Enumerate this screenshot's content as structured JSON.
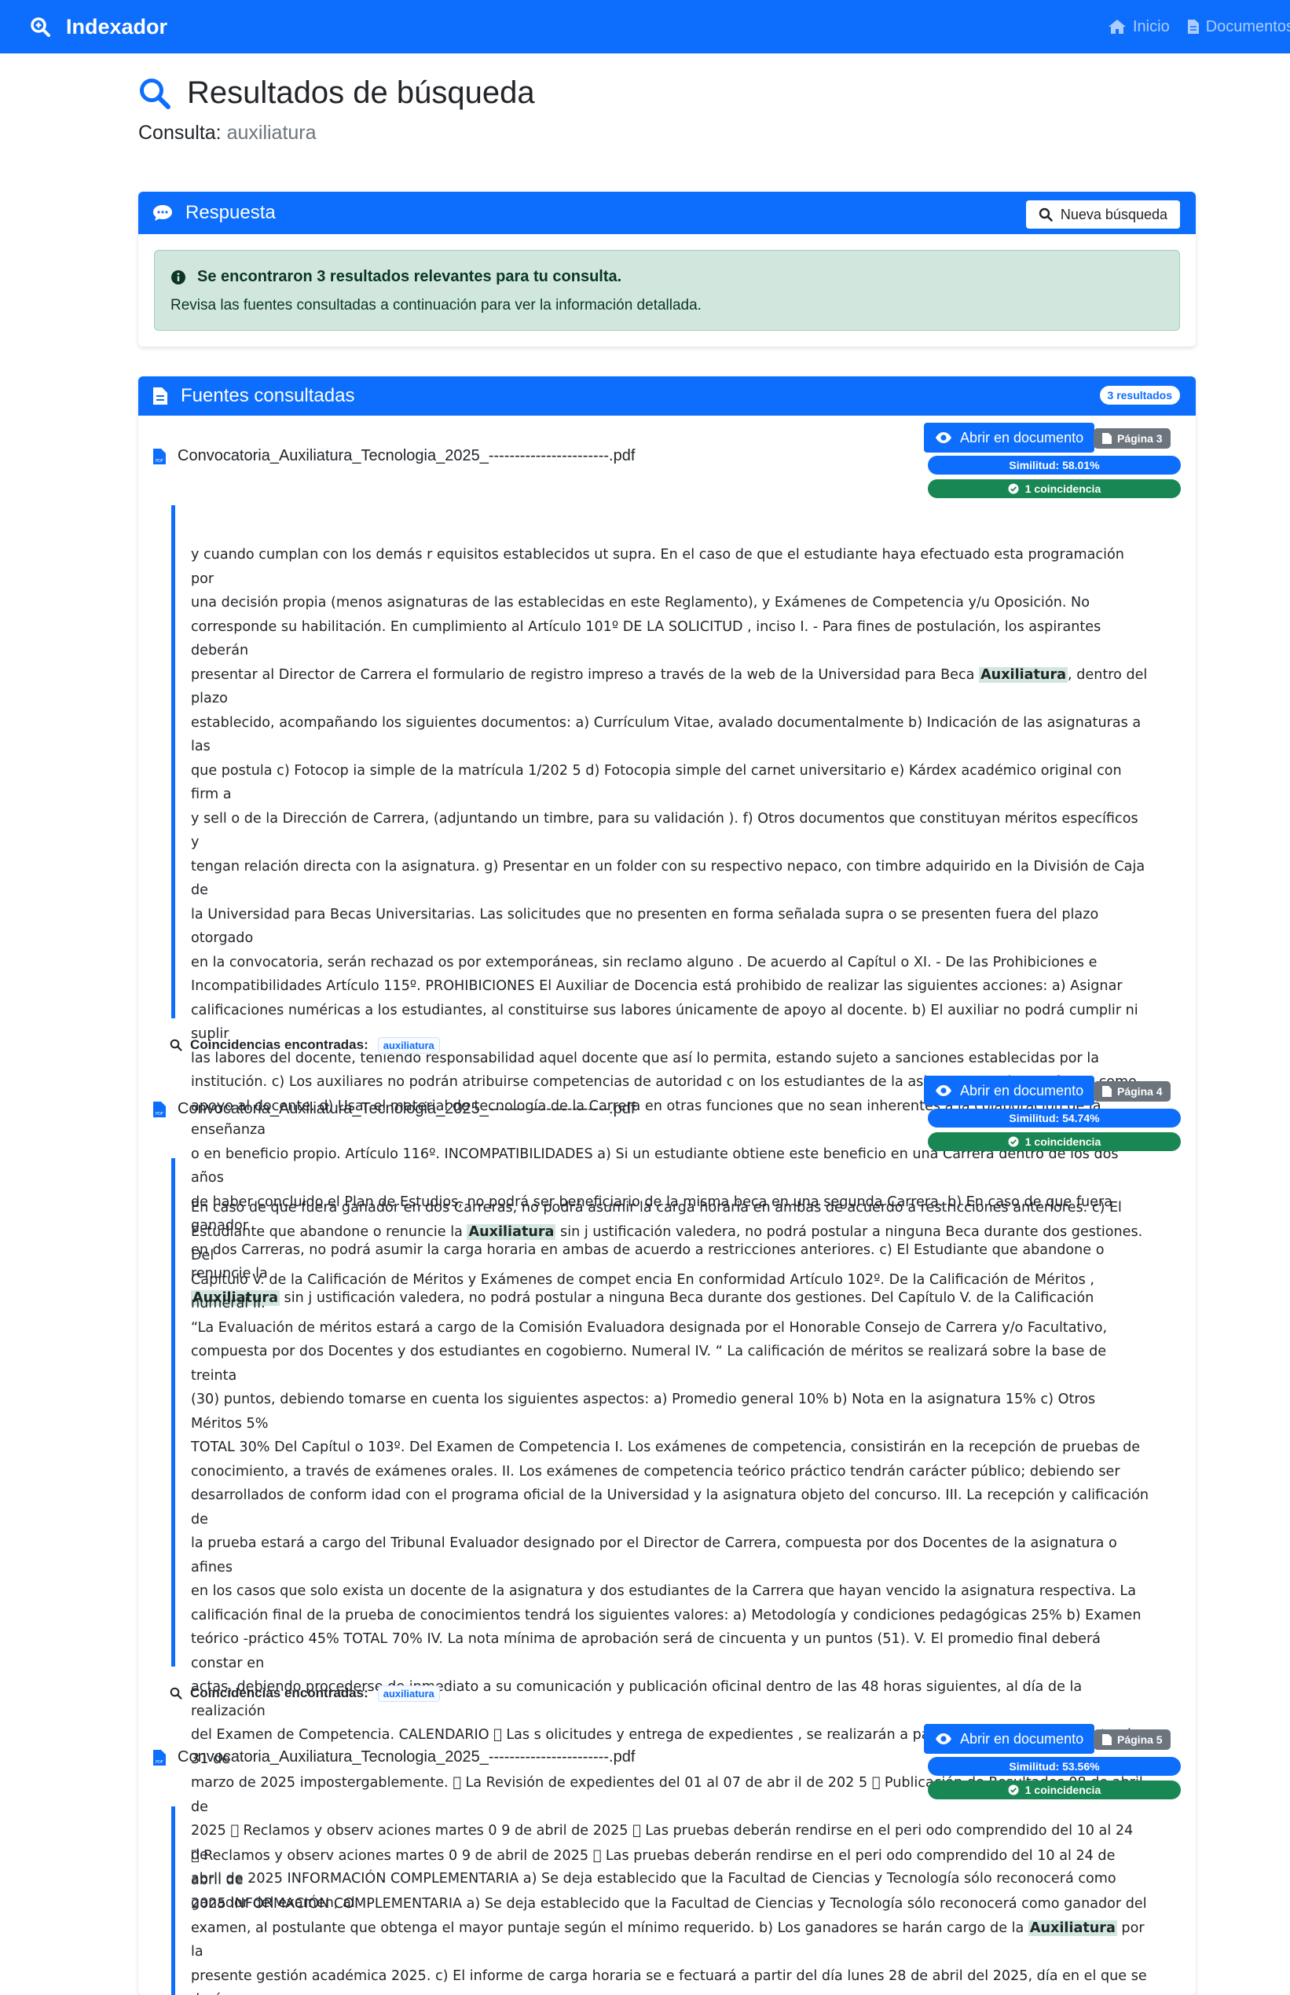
{
  "app": {
    "brand": "Indexador"
  },
  "nav": {
    "home": "Inicio",
    "documents": "Documentos"
  },
  "header": {
    "title": "Resultados de búsqueda",
    "query_label": "Consulta:",
    "query_value": "auxiliatura"
  },
  "response_card": {
    "title": "Respuesta",
    "new_search_label": "Nueva búsqueda",
    "alert_title": "Se encontraron 3 resultados relevantes para tu consulta.",
    "alert_body": "Revisa las fuentes consultadas a continuación para ver la información detallada."
  },
  "sources_card": {
    "title": "Fuentes consultadas",
    "count_badge": "3 resultados"
  },
  "results": [
    {
      "filename": "Convocatoria_Auxiliatura_Tecnologia_2025_-----------------------.pdf",
      "open_label": "Abrir en documento",
      "page_label": "Página 3",
      "similarity_label": "Similitud: 58.01%",
      "matches_label": "1 coincidencia",
      "excerpt_a": "y cuando cumplan con los demás r equisitos establecidos ut supra. En el caso de que el estudiante haya efectuado esta programación por\nuna decisión propia (menos asignaturas de las establecidas en este Reglamento), y Exámenes de Competencia y/u Oposición. No\ncorresponde su habilitación. En cumplimiento al Artículo 101º DE LA SOLICITUD , inciso I. - Para fines de postulación, los aspirantes deberán\npresentar al Director de Carrera el formulario de registro impreso a través de la web de la Universidad para Beca ",
      "excerpt_hl1": "Auxiliatura",
      "excerpt_b": ", dentro del plazo\nestablecido, acompañando los siguientes documentos: a) Currículum Vitae, avalado documentalmente b) Indicación de las asignaturas a las\nque postula c) Fotocop ia simple de la matrícula 1/202 5 d) Fotocopia simple del carnet universitario e) Kárdex académico original con firm a\ny sell o de la Dirección de Carrera, (adjuntando un timbre, para su validación ). f) Otros documentos que constituyan méritos específicos y\ntengan relación directa con la asignatura. g) Presentar en un folder con su respectivo nepaco, con timbre adquirido en la División de Caja de\nla Universidad para Becas Universitarias. Las solicitudes que no presenten en forma señalada supra o se presenten fuera del plazo otorgado\nen la convocatoria, serán rechazad os por extemporáneas, sin reclamo alguno . De acuerdo al Capítul o XI. - De las Prohibiciones e\nIncompatibilidades Artículo 115º. PROHIBICIONES El Auxiliar de Docencia está prohibido de realizar las siguientes acciones: a) Asignar\ncalificaciones numéricas a los estudiantes, al constituirse sus labores únicamente de apoyo al docente. b) El auxiliar no podrá cumplir ni suplir\nlas labores del docente, teniendo responsabilidad aquel docente que así lo permita, estando sujeto a sanciones establecidas por la\ninstitución. c) Los auxiliares no podrán atribuirse competencias de autoridad c on los estudiantes de la asignatura en la que funge como\napoyo al docente. d) Usar el material de tecnología de la Carrera en otras funciones que no sean inherentes a la colaboración de la enseñanza\no en beneficio propio. Artículo 116º. INCOMPATIBILIDADES a) Si un estudiante obtiene este beneficio en una Carrera dentro de los dos años\nde haber concluido el Plan de Estudios, no podrá ser beneficiario de la misma beca en una segunda Carrera. b) En caso de que fuera ganador\nen dos Carreras, no podrá asumir la carga horaria en ambas de acuerdo a restricciones anteriores. c) El Estudiante que abandone o renuncie la\n",
      "excerpt_hl2": "Auxiliatura",
      "excerpt_c": " sin j ustificación valedera, no podrá postular a ninguna Beca durante dos gestiones. Del Capítulo V. de la Calificación",
      "coinc_label": "Coincidencias encontradas:",
      "tag": "auxiliatura"
    },
    {
      "filename": "Convocatoria_Auxiliatura_Tecnologia_2025_-----------------------.pdf",
      "open_label": "Abrir en documento",
      "page_label": "Página 4",
      "similarity_label": "Similitud: 54.74%",
      "matches_label": "1 coincidencia",
      "excerpt_a": "En caso de que fuera ganador en dos Carreras, no podrá asumir la carga horaria en ambas de acuerdo a restricciones anteriores. c) El\nEstudiante que abandone o renuncie la ",
      "excerpt_hl1": "Auxiliatura",
      "excerpt_b": " sin j ustificación valedera, no podrá postular a ninguna Beca durante dos gestiones. Del\nCapítulo V. de la Calificación de Méritos y Exámenes de compet encia En conformidad Artículo 102º. De la Calificación de Méritos , numeral II.\n“La Evaluación de méritos estará a cargo de la Comisión Evaluadora designada por el Honorable Consejo de Carrera y/o Facultativo,\ncompuesta por dos Docentes y dos estudiantes en cogobierno. Numeral IV. “ La calificación de méritos se realizará sobre la base de treinta\n(30) puntos, debiendo tomarse en cuenta los siguientes aspectos: a) Promedio general 10% b) Nota en la asignatura 15% c) Otros Méritos 5%\nTOTAL 30% Del Capítul o 103º. Del Examen de Competencia I. Los exámenes de competencia, consistirán en la recepción de pruebas de\nconocimiento, a través de exámenes orales. II. Los exámenes de competencia teórico práctico tendrán carácter público; debiendo ser\ndesarrollados de conform idad con el programa oficial de la Universidad y la asignatura objeto del concurso. III. La recepción y calificación de\nla prueba estará a cargo del Tribunal Evaluador designado por el Director de Carrera, compuesta por dos Docentes de la asignatura o afines\nen los casos que solo exista un docente de la asignatura y dos estudiantes de la Carrera que hayan vencido la asignatura respectiva. La\ncalificación final de la prueba de conocimientos tendrá los siguientes valores: a) Metodología y condiciones pedagógicas 25% b) Examen\nteórico -práctico 45% TOTAL 70% IV. La nota mínima de aprobación será de cincuenta y un puntos (51). V. El promedio final deberá constar en\nactas, debiendo procederse de inmediato a su comunicación y publicación oficinal dentro de las 48 horas siguientes, al día de la realización\ndel Examen de Competencia. CALENDARIO  Las s olicitudes y entrega de expedientes , se realizarán a pa rtir del 20 de marzo hasta el 31 de\nmarzo de 2025 impostergablemente.  La Revisión de expedientes del 01 al 07 de abr il de 202 5  Publicación de Resultados 08 de abril de\n2025  Reclamos y observ aciones martes 0 9 de abril de 2025  Las pruebas deberán rendirse en el peri odo comprendido del 10 al 24 de\nabril de 2025 INFORMACIÓN COMPLEMENTARIA a) Se deja establecido que la Facultad de Ciencias y Tecnología sólo reconocerá como\nganador del examen, al",
      "excerpt_hl2": "",
      "excerpt_c": "",
      "coinc_label": "Coincidencias encontradas:",
      "tag": "auxiliatura"
    },
    {
      "filename": "Convocatoria_Auxiliatura_Tecnologia_2025_-----------------------.pdf",
      "open_label": "Abrir en documento",
      "page_label": "Página 5",
      "similarity_label": "Similitud: 53.56%",
      "matches_label": "1 coincidencia",
      "excerpt_a": " Reclamos y observ aciones martes 0 9 de abril de 2025  Las pruebas deberán rendirse en el peri odo comprendido del 10 al 24 de abril de\n2025 INFORMACIÓN COMPLEMENTARIA a) Se deja establecido que la Facultad de Ciencias y Tecnología sólo reconocerá como ganador del\nexamen, al postulante que obtenga el mayor puntaje según el mínimo requerido. b) Los ganadores se harán cargo de la ",
      "excerpt_hl1": "Auxiliatura",
      "excerpt_b": " por la\npresente gestión académica 2025. c) El informe de carga horaria se e fectuará a partir del día lunes 28 de abril del 2025, día en el que se dará",
      "excerpt_hl2": "",
      "excerpt_c": "",
      "coinc_label": "Coincidencias encontradas:",
      "tag": "auxiliatura"
    }
  ]
}
